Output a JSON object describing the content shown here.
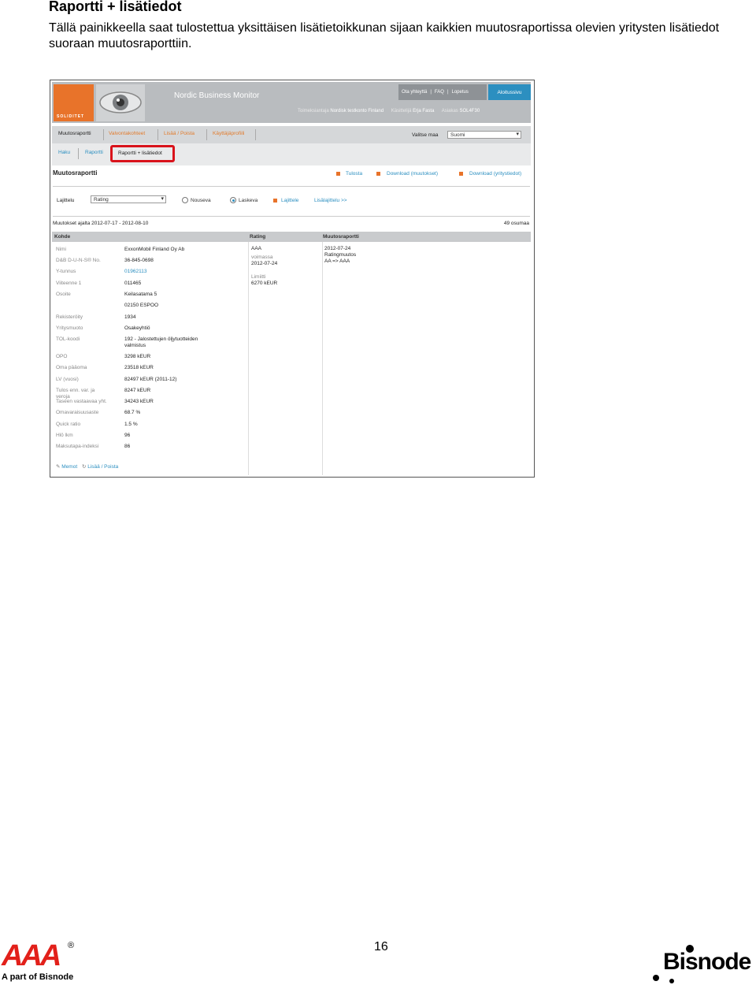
{
  "doc": {
    "title": "Raportti + lisätiedot",
    "paragraph": "Tällä painikkeella saat tulostettua yksittäisen lisätietoikkunan sijaan kaikkien muutosraportissa olevien yritysten lisätiedot suoraan muutosraporttiin.",
    "page_number": "16"
  },
  "app": {
    "logo_text": "SOLIDITET",
    "title": "Nordic Business Monitor",
    "top_links": [
      "Ota yhteyttä",
      "FAQ",
      "Lopetus"
    ],
    "home": "Aloitussivu",
    "org_label": "Toimeksiantaja",
    "org_value": "Nordisk testkonto Finland",
    "user_label": "Käsittelijä",
    "user_value": "Erja Fasta",
    "client_label": "Asiakas",
    "client_value": "SOL4F30"
  },
  "nav1": {
    "items": [
      "Muutosraportti",
      "Valvontakohteet",
      "Lisää / Poista",
      "Käyttäjäprofiili"
    ],
    "country_label": "Valitse maa",
    "country_value": "Suomi"
  },
  "nav2": {
    "items": [
      "Haku",
      "Raportti",
      "Raportti + lisätiedot"
    ]
  },
  "section": {
    "title": "Muutosraportti",
    "actions": [
      "Tulosta",
      "Download (muutokset)",
      "Download (yritystiedot)"
    ]
  },
  "sort": {
    "label": "Lajittelu",
    "value": "Rating",
    "asc": "Nouseva",
    "desc": "Laskeva",
    "apply": "Lajittele",
    "more": "Lisälajittelu >>"
  },
  "results": {
    "period": "Muutokset ajalta 2012-07-17 - 2012-08-10",
    "count": "49 osumaa",
    "headers": [
      "Kohde",
      "Rating",
      "Muutosraportti"
    ],
    "fields": [
      {
        "label": "Nimi",
        "value": "ExxonMobil Finland Oy Ab"
      },
      {
        "label": "D&B D-U-N-S® No.",
        "value": "36-845-0698"
      },
      {
        "label": "Y-tunnus",
        "value": "01962113"
      },
      {
        "label": "Viiteenne 1",
        "value": "011465"
      },
      {
        "label": "Osoite",
        "value": "Keilasatama 5"
      },
      {
        "label": "",
        "value": "02150 ESPOO"
      },
      {
        "label": "Rekisteröity",
        "value": "1934"
      },
      {
        "label": "Yritysmuoto",
        "value": "Osakeyhtiö"
      },
      {
        "label": "TOL-koodi",
        "value": "192 - Jalostettujen öljytuotteiden"
      },
      {
        "label": "",
        "value": "valmistus"
      },
      {
        "label": "OPO",
        "value": "3298 kEUR"
      },
      {
        "label": "Oma pääoma",
        "value": "23518 kEUR"
      },
      {
        "label": "LV (vuosi)",
        "value": "82497 kEUR (2011-12)"
      },
      {
        "label": "Tulos enn. var. ja",
        "value": "8247 kEUR"
      },
      {
        "label": "veroja",
        "value": ""
      },
      {
        "label": "Taseen vastaavaa yht.",
        "value": "34243 kEUR"
      },
      {
        "label": "Omavaraisuusaste",
        "value": "68.7 %"
      },
      {
        "label": "Quick ratio",
        "value": "1.5 %"
      },
      {
        "label": "Hlö lkm",
        "value": "96"
      },
      {
        "label": "Maksutapa-indeksi",
        "value": "86"
      }
    ],
    "rating": {
      "value": "AAA",
      "valid_label": "voimassa",
      "valid_date": "2012-07-24",
      "limit_label": "Limiitti",
      "limit_value": "6270 kEUR"
    },
    "change": [
      "2012-07-24",
      "Ratingmuutos",
      "AA => AAA"
    ],
    "memo": "Memot",
    "addremove": "Lisää / Poista"
  },
  "footer": {
    "aaa_mark": "AAA",
    "aaa_reg": "®",
    "aaa_sub": "A part of Bisnode",
    "bisnode": "Bisnode"
  }
}
